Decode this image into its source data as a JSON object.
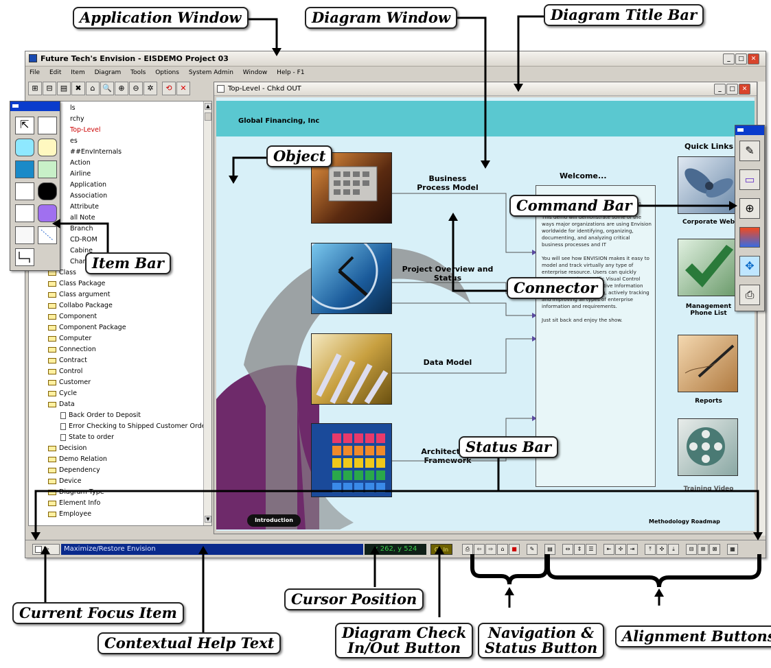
{
  "app": {
    "title": "Future Tech's Envision - EISDEMO Project 03",
    "menu": [
      "File",
      "Edit",
      "Item",
      "Diagram",
      "Tools",
      "Options",
      "System Admin",
      "Window",
      "Help - F1"
    ]
  },
  "tree": {
    "items": [
      {
        "label": "ls",
        "type": "text"
      },
      {
        "label": "rchy",
        "type": "text"
      },
      {
        "label": "Top-Level",
        "type": "text",
        "highlight": true
      },
      {
        "label": "es",
        "type": "text"
      },
      {
        "label": "##EnvInternals",
        "type": "text"
      },
      {
        "label": "Action",
        "type": "text"
      },
      {
        "label": "Airline",
        "type": "text"
      },
      {
        "label": "Application",
        "type": "text"
      },
      {
        "label": "Association",
        "type": "text"
      },
      {
        "label": "Attribute",
        "type": "text"
      },
      {
        "label": "all Note",
        "type": "text"
      },
      {
        "label": "Branch",
        "type": "text"
      },
      {
        "label": "CD-ROM",
        "type": "text"
      },
      {
        "label": "Cabine",
        "type": "text"
      },
      {
        "label": "Chann",
        "type": "text"
      },
      {
        "label": "Class",
        "type": "folder"
      },
      {
        "label": "Class Package",
        "type": "folder"
      },
      {
        "label": "Class argument",
        "type": "folder"
      },
      {
        "label": "Collabo Package",
        "type": "folder"
      },
      {
        "label": "Component",
        "type": "folder"
      },
      {
        "label": "Component Package",
        "type": "folder"
      },
      {
        "label": "Computer",
        "type": "folder"
      },
      {
        "label": "Connection",
        "type": "folder"
      },
      {
        "label": "Contract",
        "type": "folder"
      },
      {
        "label": "Control",
        "type": "folder"
      },
      {
        "label": "Customer",
        "type": "folder"
      },
      {
        "label": "Cycle",
        "type": "folder"
      },
      {
        "label": "Data",
        "type": "folder-open"
      },
      {
        "label": "Back Order to Deposit",
        "type": "child"
      },
      {
        "label": "Error Checking to Shipped Customer Order",
        "type": "child"
      },
      {
        "label": "State to order",
        "type": "child"
      },
      {
        "label": "Decision",
        "type": "folder"
      },
      {
        "label": "Demo Relation",
        "type": "folder"
      },
      {
        "label": "Dependency",
        "type": "folder"
      },
      {
        "label": "Device",
        "type": "folder"
      },
      {
        "label": "Diagram Type",
        "type": "folder"
      },
      {
        "label": "Element Info",
        "type": "folder"
      },
      {
        "label": "Employee",
        "type": "folder"
      }
    ]
  },
  "diagram": {
    "title": "Top-Level - Chkd OUT",
    "company": "Global Financing, Inc",
    "processes": [
      "Business\nProcess Model",
      "Project Overview and\nStatus",
      "Data Model",
      "Architecture\nFramework"
    ],
    "welcome_title": "Welcome...",
    "welcome_body": "business modeling, and analysis system.\n\nThis demo will demonstrate some of the ways major organizations are using Envision worldwide for identifying, organizing, documenting, and analyzing critical business processes and IT\n\nYou will see how ENVISION makes it easy to model and track virtually any type of enterprise resource. Users can quickly create enterprise specific Visual Control Centers or custom Executive Information Systems for documenting, actively tracking and improving all types of enterprise information and requirements.\n\nJust sit back and enjoy the show.",
    "quick_links_title": "Quick Links",
    "quick_links": [
      "Corporate Web",
      "Management\nPhone List",
      "Reports",
      "Training Video"
    ],
    "intro_button": "Introduction",
    "roadmap": "Methodology Roadmap"
  },
  "status": {
    "help_text": "Maximize/Restore Envision",
    "cursor": "x 262, y 524",
    "checkin": "Ck In"
  },
  "callouts": {
    "application_window": "Application Window",
    "diagram_window": "Diagram Window",
    "diagram_title_bar": "Diagram Title Bar",
    "object": "Object",
    "command_bar": "Command Bar",
    "item_bar": "Item Bar",
    "connector": "Connector",
    "status_bar": "Status Bar",
    "current_focus_item": "Current Focus Item",
    "contextual_help_text": "Contextual  Help Text",
    "cursor_position": "Cursor Position",
    "diagram_check_line1": "Diagram Check",
    "diagram_check_line2": "In/Out Button",
    "navigation_line1": "Navigation &",
    "navigation_line2": "Status Button",
    "alignment_buttons": "Alignment Buttons"
  },
  "colors": {
    "banner": "#5ac8d0",
    "canvas": "#d8f0f8",
    "help_bg": "#0a2a8c",
    "cursor_text": "#3ad04a",
    "swoosh_purple": "#6e2a6a"
  }
}
